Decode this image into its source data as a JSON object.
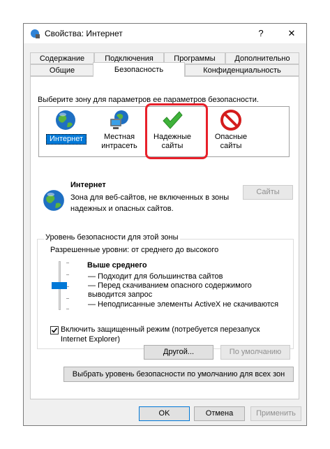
{
  "window": {
    "title": "Свойства: Интернет",
    "help_symbol": "?",
    "close_symbol": "✕"
  },
  "tabs_row1": [
    "Содержание",
    "Подключения",
    "Программы",
    "Дополнительно"
  ],
  "tabs_row2": [
    "Общие",
    "Безопасность",
    "Конфиденциальность"
  ],
  "active_tab": "Безопасность",
  "security": {
    "zones_prompt": "Выберите зону для параметров ее параметров безопасности.",
    "zones": [
      {
        "label": "Интернет",
        "icon": "globe-icon",
        "selected": true
      },
      {
        "label": "Местная\nинтрасеть",
        "icon": "intranet-icon",
        "selected": false
      },
      {
        "label": "Надежные\nсайты",
        "icon": "checkmark-icon",
        "selected": false
      },
      {
        "label": "Опасные\nсайты",
        "icon": "restricted-icon",
        "selected": false
      }
    ],
    "zone_name": "Интернет",
    "zone_description": "Зона для веб-сайтов, не включенных в зоны надежных и опасных сайтов.",
    "sites_button": "Сайты",
    "level_group_title": "Уровень безопасности для этой зоны",
    "allowed_levels": "Разрешенные уровни: от среднего до высокого",
    "level_name": "Выше среднего",
    "level_bullets": [
      "— Подходит для большинства сайтов",
      "— Перед скачиванием опасного содержимого выводится запрос",
      "— Неподписанные элементы ActiveX не скачиваются"
    ],
    "protected_mode_checked": true,
    "protected_mode_label": "Включить защищенный режим (потребуется перезапуск Internet Explorer)",
    "custom_button": "Другой...",
    "default_button": "По умолчанию",
    "reset_all_button": "Выбрать уровень безопасности по умолчанию для всех зон"
  },
  "footer": {
    "ok": "OK",
    "cancel": "Отмена",
    "apply": "Применить"
  },
  "colors": {
    "highlight_red": "#e8202a",
    "selection_blue": "#0078d7",
    "slider_thumb": "#0078d7"
  }
}
